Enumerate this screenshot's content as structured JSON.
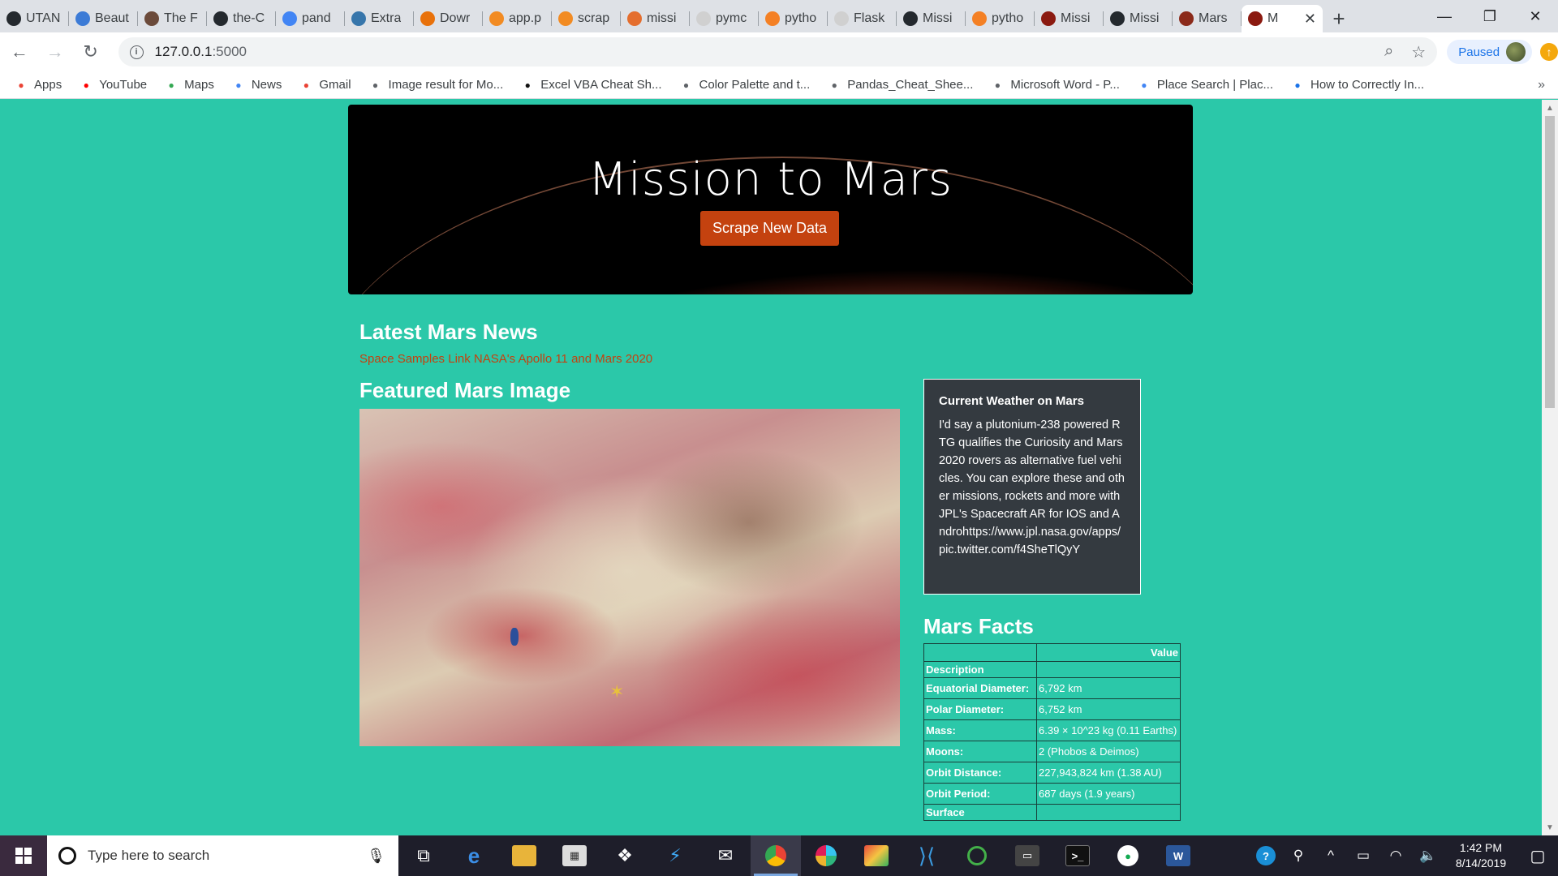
{
  "browser": {
    "tabs": [
      {
        "label": "UTAN",
        "icon": "github-icon",
        "color": "#24292e"
      },
      {
        "label": "Beaut",
        "icon": "c-icon",
        "color": "#3c7bd6"
      },
      {
        "label": "The F",
        "icon": "thumbnail-icon",
        "color": "#6b4a3a"
      },
      {
        "label": "the-C",
        "icon": "github-icon",
        "color": "#24292e"
      },
      {
        "label": "pand",
        "icon": "google-icon",
        "color": "#4285f4"
      },
      {
        "label": "Extra",
        "icon": "python-icon",
        "color": "#3776ab"
      },
      {
        "label": "Dowr",
        "icon": "loading-icon",
        "color": "#e8710a"
      },
      {
        "label": "app.p",
        "icon": "file-icon",
        "color": "#f28b22"
      },
      {
        "label": "scrap",
        "icon": "file-icon",
        "color": "#f28b22"
      },
      {
        "label": "missi",
        "icon": "jupyter-icon",
        "color": "#e46e2e"
      },
      {
        "label": "pymc",
        "icon": "leaf-icon",
        "color": "#d0d0d0"
      },
      {
        "label": "pytho",
        "icon": "stack-icon",
        "color": "#f48024"
      },
      {
        "label": "Flask",
        "icon": "leaf-icon",
        "color": "#d0d0d0"
      },
      {
        "label": "Missi",
        "icon": "github-icon",
        "color": "#24292e"
      },
      {
        "label": "pytho",
        "icon": "stack-icon",
        "color": "#f48024"
      },
      {
        "label": "Missi",
        "icon": "mars-icon",
        "color": "#8b1a10"
      },
      {
        "label": "Missi",
        "icon": "github-icon",
        "color": "#24292e"
      },
      {
        "label": "Mars",
        "icon": "mars-icon",
        "color": "#8b2a1a"
      }
    ],
    "active_tab": {
      "label": "M",
      "icon": "mars-icon",
      "color": "#8b1a10"
    },
    "new_tab": "+",
    "address": {
      "host": "127.0.0.1",
      "port": ":5000"
    },
    "paused_label": "Paused",
    "bookmarks": [
      {
        "label": "Apps",
        "icon": "apps-grid-icon",
        "color": "#ea4335"
      },
      {
        "label": "YouTube",
        "icon": "youtube-icon",
        "color": "#ff0000"
      },
      {
        "label": "Maps",
        "icon": "maps-icon",
        "color": "#34a853"
      },
      {
        "label": "News",
        "icon": "news-icon",
        "color": "#4285f4"
      },
      {
        "label": "Gmail",
        "icon": "gmail-icon",
        "color": "#ea4335"
      },
      {
        "label": "Image result for Mo...",
        "icon": "globe-icon",
        "color": "#5f6368"
      },
      {
        "label": "Excel VBA Cheat Sh...",
        "icon": "bookmark-thumb-icon",
        "color": "#111111"
      },
      {
        "label": "Color Palette and t...",
        "icon": "globe-icon",
        "color": "#5f6368"
      },
      {
        "label": "Pandas_Cheat_Shee...",
        "icon": "globe-icon",
        "color": "#5f6368"
      },
      {
        "label": "Microsoft Word - P...",
        "icon": "globe-icon",
        "color": "#5f6368"
      },
      {
        "label": "Place Search | Plac...",
        "icon": "code-icon",
        "color": "#4285f4"
      },
      {
        "label": "How to Correctly In...",
        "icon": "flag-icon",
        "color": "#1a73e8"
      }
    ],
    "bookmarks_more": "»"
  },
  "page": {
    "heading": "Mission to Mars",
    "scrape_button": "Scrape New Data",
    "news_title": "Latest Mars News",
    "news_headline": "Space Samples Link NASA's Apollo 11 and Mars 2020",
    "image_title": "Featured Mars Image",
    "weather": {
      "title": "Current Weather on Mars",
      "text": "I'd say a plutonium-238 powered RTG qualifies the Curiosity and Mars2020 rovers as alternative fuel vehicles. You can explore these and other missions, rockets and more with JPL's Spacecraft AR for IOS and Androhttps://www.jpl.nasa.gov/apps/pic.twitter.com/f4SheTlQyY"
    },
    "facts": {
      "title": "Mars Facts",
      "column_header": "Value",
      "index_header": "Description",
      "rows": [
        {
          "key": "Equatorial Diameter:",
          "value": "6,792 km"
        },
        {
          "key": "Polar Diameter:",
          "value": "6,752 km"
        },
        {
          "key": "Mass:",
          "value": "6.39 × 10^23 kg (0.11 Earths)"
        },
        {
          "key": "Moons:",
          "value": "2 (Phobos & Deimos)"
        },
        {
          "key": "Orbit Distance:",
          "value": "227,943,824 km (1.38 AU)"
        },
        {
          "key": "Orbit Period:",
          "value": "687 days (1.9 years)"
        },
        {
          "key": "Surface",
          "value": ""
        }
      ]
    }
  },
  "taskbar": {
    "search_placeholder": "Type here to search",
    "time": "1:42 PM",
    "date": "8/14/2019"
  },
  "colors": {
    "page_background": "#2bc8a9",
    "accent_orange": "#c4420f",
    "weather_card": "#343a40"
  }
}
